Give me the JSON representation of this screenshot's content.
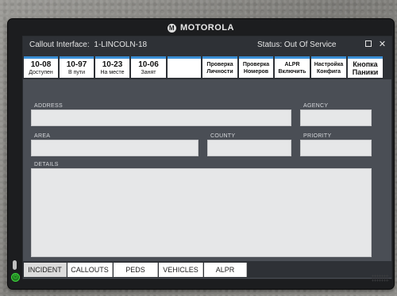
{
  "device": {
    "brand": "MOTOROLA",
    "logo_glyph": "M"
  },
  "window": {
    "title_label": "Callout Interface:",
    "callout_id": "1-LINCOLN-18",
    "status_label": "Status:",
    "status_value": "Out Of Service",
    "maximize_icon": "maximize-icon",
    "close_glyph": "✕"
  },
  "toolbar": {
    "status_buttons": [
      {
        "code": "10-08",
        "sub": "Доступен"
      },
      {
        "code": "10-97",
        "sub": "В пути"
      },
      {
        "code": "10-23",
        "sub": "На месте"
      },
      {
        "code": "10-06",
        "sub": "Занят"
      }
    ],
    "action_buttons": [
      {
        "line1": "Проверка",
        "line2": "Личности"
      },
      {
        "line1": "Проверка",
        "line2": "Номеров"
      },
      {
        "line1": "ALPR",
        "line2": "Включить"
      },
      {
        "line1": "Настройка",
        "line2": "Конфига"
      },
      {
        "line1": "Кнопка",
        "line2": "Паники"
      }
    ]
  },
  "form": {
    "address": {
      "label": "ADDRESS",
      "value": ""
    },
    "agency": {
      "label": "AGENCY",
      "value": ""
    },
    "area": {
      "label": "AREA",
      "value": ""
    },
    "county": {
      "label": "COUNTY",
      "value": ""
    },
    "priority": {
      "label": "PRIORITY",
      "value": ""
    },
    "details": {
      "label": "DETAILS",
      "value": ""
    }
  },
  "tabs": [
    {
      "label": "INCIDENT",
      "active": true
    },
    {
      "label": "CALLOUTS",
      "active": false
    },
    {
      "label": "PEDS",
      "active": false
    },
    {
      "label": "VEHICLES",
      "active": false
    },
    {
      "label": "ALPR",
      "active": false
    }
  ],
  "colors": {
    "accent": "#3a8fd6",
    "window_bg": "#4a4e55",
    "titlebar_bg": "#2e3136",
    "power_led": "#3fd93f"
  }
}
